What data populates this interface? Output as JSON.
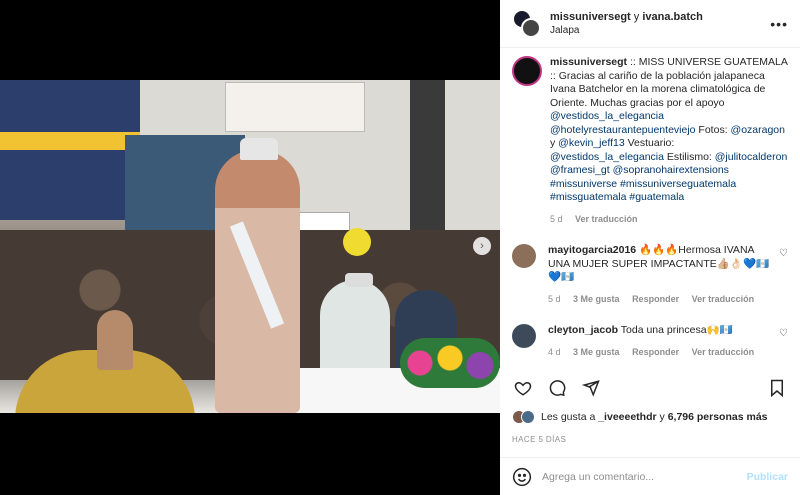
{
  "header": {
    "user1": "missuniversegt",
    "joiner": "y",
    "user2": "ivana.batch",
    "location": "Jalapa",
    "more_icon": "more-horizontal-icon"
  },
  "media": {
    "next_icon": "chevron-right-icon",
    "next_glyph": "›"
  },
  "caption": {
    "username": "missuniversegt",
    "text_1": ":: MISS UNIVERSE GUATEMALA :: Gracias al cariño de la población jalapaneca Ivana Batchelor en la morena climatológica de Oriente. Muchas gracias por el apoyo ",
    "mention_1": "@vestidos_la_elegancia",
    "mention_2": "@hotelyrestaurantepuenteviejo",
    "text_2": " Fotos: ",
    "mention_3": "@ozaragon",
    "text_3": " y ",
    "mention_4": "@kevin_jeff13",
    "text_4": " Vestuario: ",
    "mention_5": "@vestidos_la_elegancia",
    "text_5": " Estilismo: ",
    "mention_6": "@julitocalderon",
    "mention_7": "@framesi_gt",
    "mention_8": "@sopranohairextensions",
    "tag_1": "#missuniverse",
    "tag_2": "#missuniverseguatemala",
    "tag_3": "#missguatemala",
    "tag_4": "#guatemala",
    "time": "5 d",
    "translate": "Ver traducción"
  },
  "comments": [
    {
      "username": "mayitogarcia2016",
      "text": "🔥🔥🔥Hermosa IVANA UNA MUJER SUPER IMPACTANTE👍🏼👌🏻💙🇬🇹💙🇬🇹",
      "time": "5 d",
      "likes": "3 Me gusta",
      "reply": "Responder",
      "translate": "Ver traducción"
    },
    {
      "username": "cleyton_jacob",
      "text": "Toda una princesa🙌🇬🇹",
      "time": "4 d",
      "likes": "3 Me gusta",
      "reply": "Responder",
      "translate": "Ver traducción"
    }
  ],
  "actions": {
    "like_icon": "heart-icon",
    "comment_icon": "comment-icon",
    "share_icon": "send-icon",
    "save_icon": "bookmark-icon"
  },
  "likes": {
    "prefix": "Les gusta a ",
    "user": "_iveeeethdr",
    "middle": " y ",
    "count": "6,796 personas más"
  },
  "time_ago": "HACE 5 DÍAS",
  "add_comment": {
    "placeholder": "Agrega un comentario...",
    "publish": "Publicar",
    "emoji_icon": "smiley-icon"
  }
}
